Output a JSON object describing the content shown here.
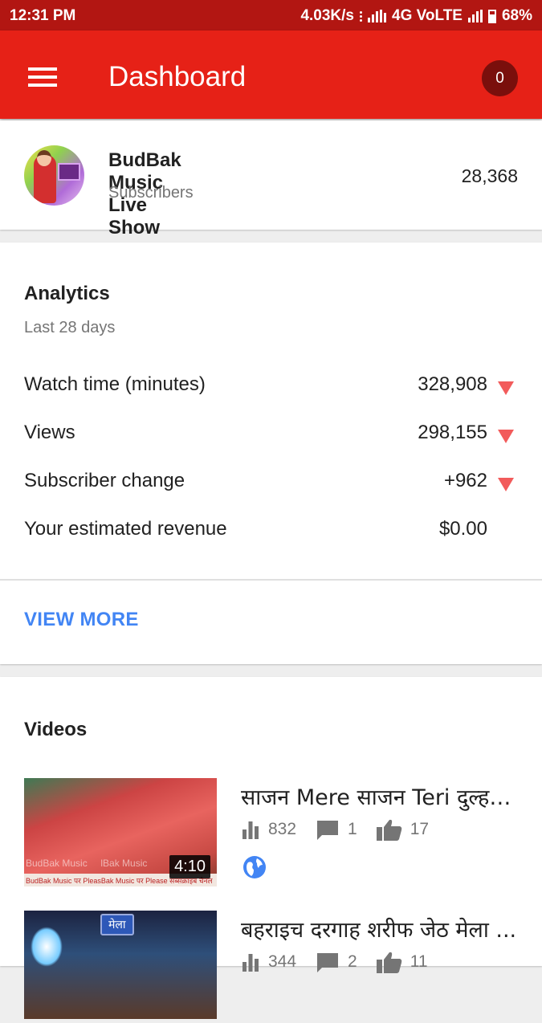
{
  "status_bar": {
    "time": "12:31 PM",
    "speed": "4.03K/s",
    "network": "4G VoLTE",
    "battery": "68%"
  },
  "app_bar": {
    "title": "Dashboard",
    "notification_count": "0"
  },
  "channel": {
    "name": "BudBak Music Live Show",
    "subscribers_label": "Subscribers",
    "subscribers_count": "28,368"
  },
  "analytics": {
    "title": "Analytics",
    "period": "Last 28 days",
    "metrics": [
      {
        "label": "Watch time (minutes)",
        "value": "328,908",
        "trend": "down"
      },
      {
        "label": "Views",
        "value": "298,155",
        "trend": "down"
      },
      {
        "label": "Subscriber change",
        "value": "+962",
        "trend": "down"
      },
      {
        "label": "Your estimated revenue",
        "value": "$0.00",
        "trend": "none"
      }
    ],
    "view_more": "VIEW MORE"
  },
  "videos": {
    "title": "Videos",
    "items": [
      {
        "title": "साजन Mere साजन Teri दुल्हन ...",
        "duration": "4:10",
        "views": "832",
        "comments": "1",
        "likes": "17",
        "thumb_text": "BudBak Music पर PleasBak Music पर Please सब्सक्राइब चैनल"
      },
      {
        "title": "बहराइच दरगाह शरीफ जेठ मेला ...",
        "duration": "",
        "views": "344",
        "comments": "2",
        "likes": "11",
        "thumb_text": "मेला"
      }
    ]
  },
  "colors": {
    "app_bar": "#e62117",
    "status_bar": "#b21612",
    "accent_link": "#4285f4",
    "trend_down": "#f25b5b"
  }
}
